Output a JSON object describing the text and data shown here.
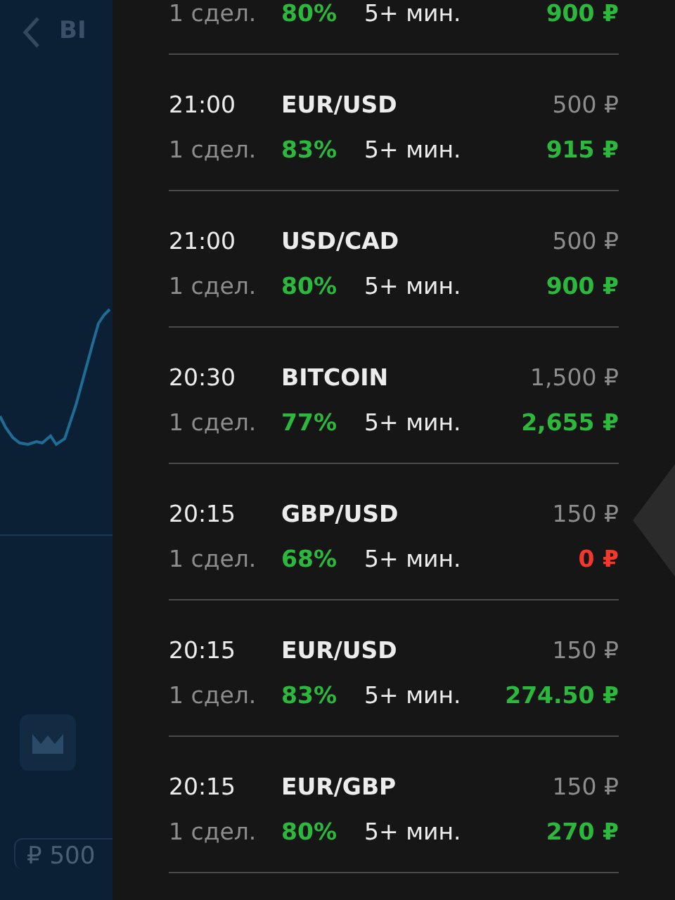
{
  "background": {
    "title": "BI",
    "amount": "₽ 500"
  },
  "trades": [
    {
      "count": "1 сдел.",
      "payout": "80%",
      "duration": "5+ мин.",
      "result": "900 ₽",
      "color": "#2cb83c"
    },
    {
      "time": "21:00",
      "pair": "EUR/USD",
      "stake": "500 ₽",
      "count": "1 сдел.",
      "payout": "83%",
      "duration": "5+ мин.",
      "result": "915 ₽",
      "color": "#2cb83c"
    },
    {
      "time": "21:00",
      "pair": "USD/CAD",
      "stake": "500 ₽",
      "count": "1 сдел.",
      "payout": "80%",
      "duration": "5+ мин.",
      "result": "900 ₽",
      "color": "#2cb83c"
    },
    {
      "time": "20:30",
      "pair": "BITCOIN",
      "stake": "1,500 ₽",
      "count": "1 сдел.",
      "payout": "77%",
      "duration": "5+ мин.",
      "result": "2,655 ₽",
      "color": "#2cb83c"
    },
    {
      "time": "20:15",
      "pair": "GBP/USD",
      "stake": "150 ₽",
      "count": "1 сдел.",
      "payout": "68%",
      "duration": "5+ мин.",
      "result": "0 ₽",
      "color": "#f2392b"
    },
    {
      "time": "20:15",
      "pair": "EUR/USD",
      "stake": "150 ₽",
      "count": "1 сдел.",
      "payout": "83%",
      "duration": "5+ мин.",
      "result": "274.50 ₽",
      "color": "#2cb83c"
    },
    {
      "time": "20:15",
      "pair": "EUR/GBP",
      "stake": "150 ₽",
      "count": "1 сдел.",
      "payout": "80%",
      "duration": "5+ мин.",
      "result": "270 ₽",
      "color": "#2cb83c"
    }
  ]
}
